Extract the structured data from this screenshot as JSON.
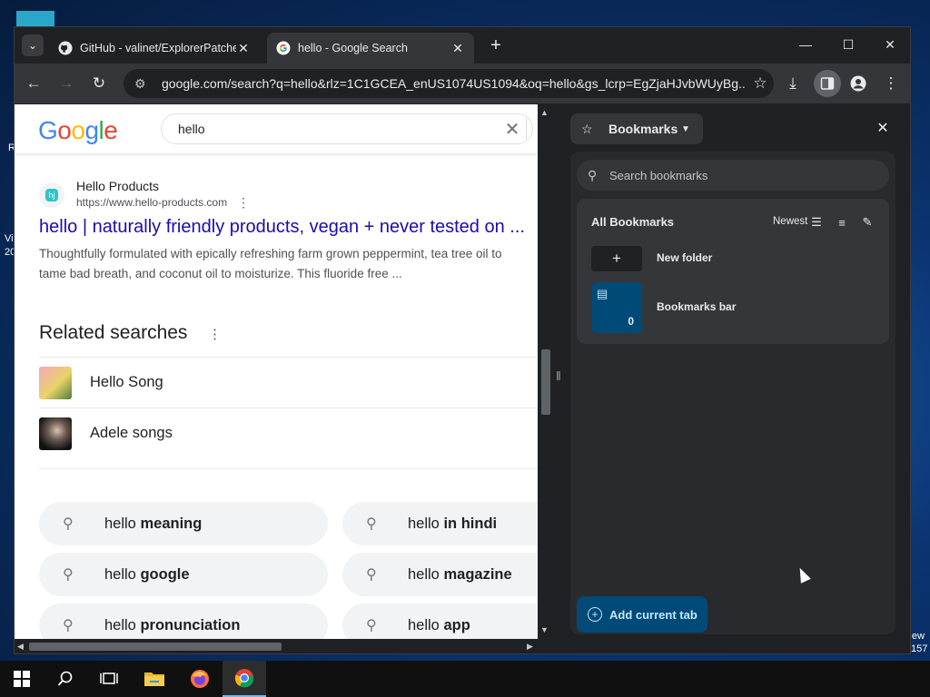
{
  "desktop": {
    "left_edge_texts": [
      "R",
      "Vi",
      "20"
    ],
    "right_edge_texts": [
      "ew",
      "157"
    ]
  },
  "browser": {
    "tabs": [
      {
        "title": "GitHub - valinet/ExplorerPatche",
        "icon": "github-icon",
        "active": false
      },
      {
        "title": "hello - Google Search",
        "icon": "google-icon",
        "active": true
      }
    ],
    "url": "google.com/search?q=hello&rlz=1C1GCEA_enUS1074US1094&oq=hello&gs_lcrp=EgZjaHJvbWUyBg...",
    "accent_color": "#004a77"
  },
  "google": {
    "logo_letters": [
      "G",
      "o",
      "o",
      "g",
      "l",
      "e"
    ],
    "logo_colors": [
      "#4285f4",
      "#ea4335",
      "#fbbc05",
      "#4285f4",
      "#34a853",
      "#ea4335"
    ],
    "query": "hello",
    "result": {
      "site_name": "Hello Products",
      "site_url": "https://www.hello-products.com",
      "favicon_text": "hj",
      "title": "hello | naturally friendly products, vegan + never tested on ...",
      "snippet": "Thoughtfully formulated with epically refreshing farm grown peppermint, tea tree oil to tame bad breath, and coconut oil to moisturize. This fluoride free ..."
    },
    "related_heading": "Related searches",
    "related": [
      {
        "label": "Hello Song"
      },
      {
        "label": "Adele songs"
      }
    ],
    "suggestions": [
      {
        "prefix": "hello ",
        "bold": "meaning"
      },
      {
        "prefix": "hello ",
        "bold": "in hindi"
      },
      {
        "prefix": "hello ",
        "bold": "google"
      },
      {
        "prefix": "hello ",
        "bold": "magazine"
      },
      {
        "prefix": "hello ",
        "bold": "pronunciation"
      },
      {
        "prefix": "hello ",
        "bold": "app"
      }
    ]
  },
  "side_panel": {
    "title": "Bookmarks",
    "search_placeholder": "Search bookmarks",
    "section_title": "All Bookmarks",
    "sort_label": "Newest",
    "new_folder_label": "New folder",
    "folder": {
      "name": "Bookmarks bar",
      "count": "0"
    },
    "add_button_label": "Add current tab"
  }
}
